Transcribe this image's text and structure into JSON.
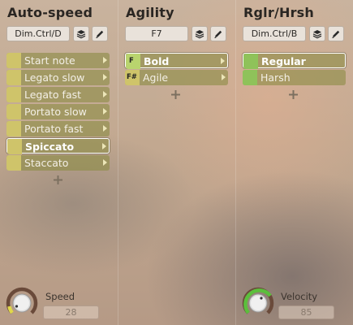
{
  "columns": [
    {
      "title": "Auto-speed",
      "key_field": "Dim.Ctrl/D",
      "items": [
        {
          "label": "Start note",
          "key": ""
        },
        {
          "label": "Legato slow",
          "key": ""
        },
        {
          "label": "Legato fast",
          "key": ""
        },
        {
          "label": "Portato slow",
          "key": ""
        },
        {
          "label": "Portato fast",
          "key": ""
        },
        {
          "label": "Spiccato",
          "key": ""
        },
        {
          "label": "Staccato",
          "key": ""
        }
      ],
      "selected_item": "Spiccato",
      "knob": {
        "label": "Speed",
        "value": "28"
      }
    },
    {
      "title": "Agility",
      "key_field": "F7",
      "items": [
        {
          "label": "Bold",
          "key": "F"
        },
        {
          "label": "Agile",
          "key": "F#"
        }
      ],
      "selected_item": "Bold"
    },
    {
      "title": "Rglr/Hrsh",
      "key_field": "Dim.Ctrl/B",
      "items": [
        {
          "label": "Regular",
          "key": ""
        },
        {
          "label": "Harsh",
          "key": ""
        }
      ],
      "selected_item": "Regular",
      "knob": {
        "label": "Velocity",
        "value": "85"
      }
    }
  ],
  "icons": {
    "layers": "layers-icon",
    "edit": "pencil-icon",
    "add": "plus-icon"
  },
  "colors": {
    "item_bg": "#8c8c46",
    "swatch_yellow": "#cfc46a",
    "swatch_green": "#8fc25a",
    "swatch_lightgreen": "#b9d46e",
    "knob_arc_yellow": "#e0d84a",
    "knob_arc_green": "#5bbf3c"
  }
}
